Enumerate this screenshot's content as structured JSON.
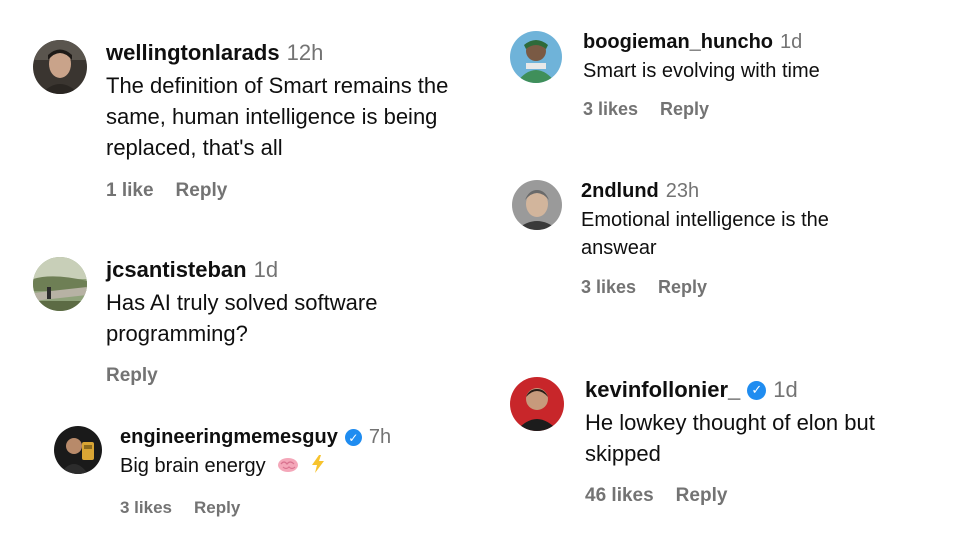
{
  "colors": {
    "verified": "#1f8cf0",
    "muted": "#737373",
    "text": "#0f0f0f"
  },
  "comments": {
    "c1": {
      "username": "wellingtonlarads",
      "time": "12h",
      "text": "The definition of Smart remains the same, human intelligence is being replaced, that's all",
      "likes": "1 like",
      "reply": "Reply"
    },
    "c2": {
      "username": "jcsantisteban",
      "time": "1d",
      "text": "Has AI truly solved software programming?",
      "reply": "Reply"
    },
    "c3": {
      "username": "engineeringmemesguy",
      "verified": true,
      "verified_icon": "check-badge-icon",
      "time": "7h",
      "text": "Big brain energy",
      "emoji": [
        "brain-icon",
        "lightning-icon"
      ],
      "likes": "3 likes",
      "reply": "Reply"
    },
    "c4": {
      "username": "boogieman_huncho",
      "time": "1d",
      "text": "Smart is evolving with time",
      "likes": "3 likes",
      "reply": "Reply"
    },
    "c5": {
      "username": "2ndlund",
      "time": "23h",
      "text": "Emotional intelligence is the answear",
      "likes": "3 likes",
      "reply": "Reply"
    },
    "c6": {
      "username": "kevinfollonier_",
      "verified": true,
      "verified_icon": "check-badge-icon",
      "time": "1d",
      "text": "He lowkey thought of elon but skipped",
      "likes": "46 likes",
      "reply": "Reply"
    }
  }
}
